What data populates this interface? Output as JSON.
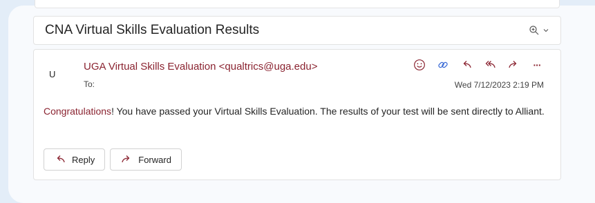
{
  "email": {
    "subject": "CNA Virtual Skills Evaluation Results",
    "avatar_initial": "U",
    "sender": "UGA Virtual Skills Evaluation <qualtrics@uga.edu>",
    "to_label": "To:",
    "date": "Wed 7/12/2023 2:19 PM",
    "body_highlight": "Congratulations",
    "body_rest": "! You have passed your Virtual Skills Evaluation. The results of your test will be sent directly to Alliant.",
    "more_label": "···"
  },
  "buttons": {
    "reply_label": "Reply",
    "forward_label": "Forward"
  },
  "colors": {
    "accent": "#8a2330",
    "icon_blue": "#3b6bd6",
    "background": "#e3edf8"
  },
  "icons": {
    "zoom": "zoom-in-icon",
    "emoji": "emoji-icon",
    "loop": "loop-icon",
    "reply": "reply-icon",
    "reply_all": "reply-all-icon",
    "forward": "forward-icon",
    "more": "more-icon"
  }
}
